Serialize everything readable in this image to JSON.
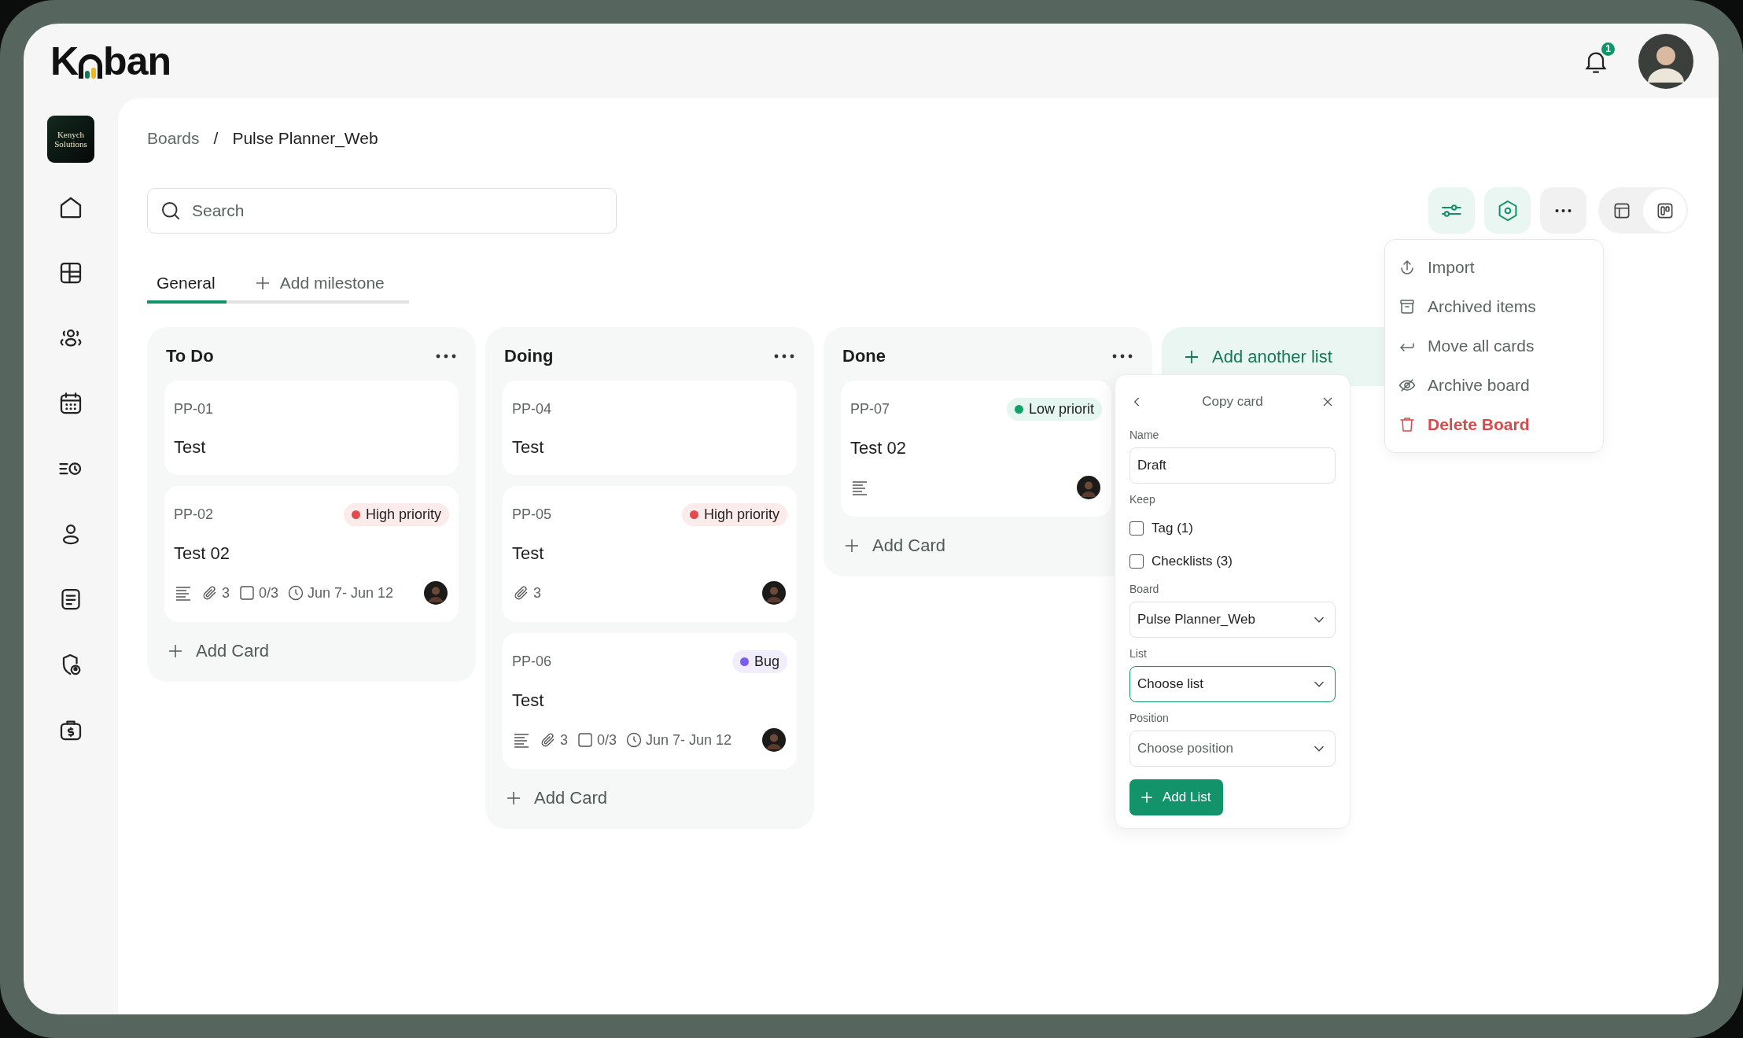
{
  "logo": {
    "before": "K",
    "after": "ban"
  },
  "notifications": {
    "count": "1"
  },
  "sidebar": {
    "workspace_logo": "Kenych Solutions",
    "items": [
      {
        "kind": "home"
      },
      {
        "kind": "layout"
      },
      {
        "kind": "team"
      },
      {
        "kind": "calendar"
      },
      {
        "kind": "timeline"
      },
      {
        "kind": "user"
      },
      {
        "kind": "document"
      },
      {
        "kind": "shield"
      },
      {
        "kind": "wallet"
      }
    ]
  },
  "breadcrumb": {
    "items": [
      "Boards",
      "Pulse Planner_Web"
    ],
    "separator": "/"
  },
  "search": {
    "placeholder": "Search"
  },
  "tabs": [
    {
      "kind": "tab",
      "label": "General",
      "selected": true
    },
    {
      "kind": "add",
      "label": "Add milestone",
      "selected": false
    }
  ],
  "toolbar": [
    {
      "kind": "filter"
    },
    {
      "kind": "settings"
    },
    {
      "kind": "more"
    }
  ],
  "view_toggle": [
    {
      "kind": "table",
      "selected": false
    },
    {
      "kind": "board",
      "selected": true
    }
  ],
  "columns": [
    {
      "title": "To Do",
      "add_label": "Add Card",
      "cards": [
        {
          "id": "PP-01",
          "title": "Test"
        },
        {
          "id": "PP-02",
          "title": "Test 02",
          "tag": {
            "label": "High priority",
            "color": "#e5484d"
          },
          "description": true,
          "attachments": "3",
          "checklist": "0/3",
          "dates": "Jun 7- Jun 12",
          "assignee": true
        }
      ]
    },
    {
      "title": "Doing",
      "add_label": "Add Card",
      "cards": [
        {
          "id": "PP-04",
          "title": "Test"
        },
        {
          "id": "PP-05",
          "title": "Test",
          "tag": {
            "label": "High priority",
            "color": "#e5484d"
          },
          "attachments": "3",
          "assignee": true
        },
        {
          "id": "PP-06",
          "title": "Test",
          "tag": {
            "label": "Bug",
            "color": "#7b5cf0"
          },
          "description": true,
          "attachments": "3",
          "checklist": "0/3",
          "dates": "Jun 7- Jun 12",
          "assignee": true
        }
      ]
    },
    {
      "title": "Done",
      "add_label": "Add Card",
      "cards": [
        {
          "id": "PP-07",
          "title": "Test 02",
          "tag": {
            "label": "Low priorit",
            "color": "#12a06a"
          },
          "description": true,
          "assignee": true
        }
      ]
    }
  ],
  "add_list": {
    "label": "Add another list"
  },
  "menu": [
    {
      "kind": "import",
      "label": "Import",
      "danger": false
    },
    {
      "kind": "archive-box",
      "label": "Archived items",
      "danger": false
    },
    {
      "kind": "move",
      "label": "Move all cards",
      "danger": false
    },
    {
      "kind": "hide",
      "label": "Archive board",
      "danger": false
    },
    {
      "kind": "trash",
      "label": "Delete Board",
      "danger": true
    }
  ],
  "copy_card": {
    "title": "Copy card",
    "name_label": "Name",
    "name_value": "Draft",
    "keep_label": "Keep",
    "keep": [
      {
        "label": "Tag (1)",
        "checked": false
      },
      {
        "label": "Checklists (3)",
        "checked": false
      }
    ],
    "selects": [
      {
        "label": "Board",
        "value": "Pulse Planner_Web",
        "focused": false
      },
      {
        "label": "List",
        "placeholder": "Choose list",
        "focused": true
      },
      {
        "label": "Position",
        "placeholder": "Choose position",
        "focused": false
      }
    ],
    "button": "Add List"
  }
}
